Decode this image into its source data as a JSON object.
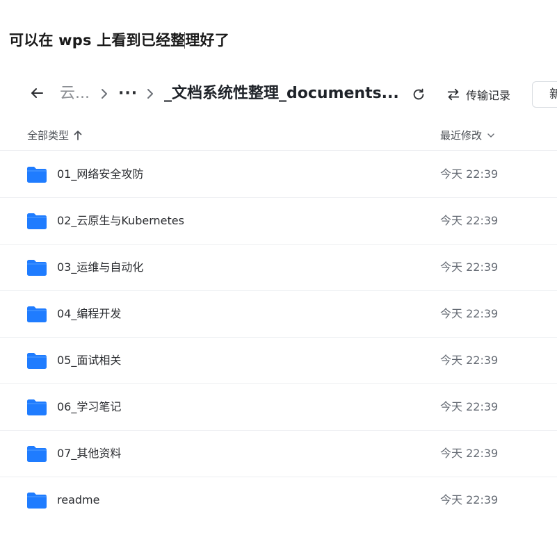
{
  "caption": {
    "text": "可以在 wps 上看到已经整理好了"
  },
  "header": {
    "back_icon": "arrow-left-icon",
    "breadcrumb": {
      "root_label": "云...",
      "more_label": "···",
      "current_label": "_文档系统性整理_documents..."
    },
    "refresh_icon": "refresh-icon",
    "transfer": {
      "icon": "transfer-arrows-icon",
      "label": "传输记录"
    },
    "new_button_label": "新建"
  },
  "columns": {
    "type_label": "全部类型",
    "type_sort_icon": "arrow-up-icon",
    "modified_label": "最近修改",
    "modified_sort_icon": "chevron-down-icon"
  },
  "colors": {
    "folder": "#1f7cff",
    "folder_tab": "#2f86ff",
    "divider": "#eceef1"
  },
  "files": [
    {
      "name": "01_网络安全攻防",
      "modified": "今天 22:39",
      "icon": "folder-icon"
    },
    {
      "name": "02_云原生与Kubernetes",
      "modified": "今天 22:39",
      "icon": "folder-icon"
    },
    {
      "name": "03_运维与自动化",
      "modified": "今天 22:39",
      "icon": "folder-icon"
    },
    {
      "name": "04_编程开发",
      "modified": "今天 22:39",
      "icon": "folder-icon"
    },
    {
      "name": "05_面试相关",
      "modified": "今天 22:39",
      "icon": "folder-icon"
    },
    {
      "name": "06_学习笔记",
      "modified": "今天 22:39",
      "icon": "folder-icon"
    },
    {
      "name": "07_其他资料",
      "modified": "今天 22:39",
      "icon": "folder-icon"
    },
    {
      "name": "readme",
      "modified": "今天 22:39",
      "icon": "folder-icon"
    }
  ]
}
